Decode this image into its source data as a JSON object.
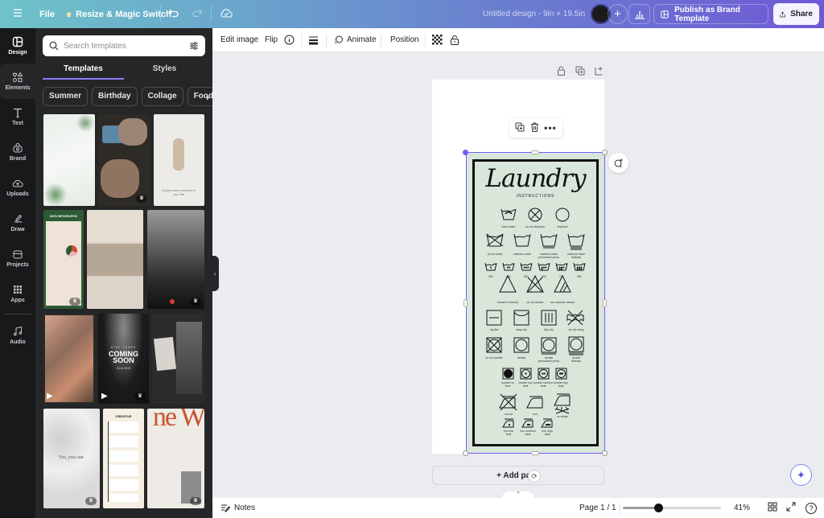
{
  "topbar": {
    "menu_icon": "hamburger-icon",
    "file_label": "File",
    "resize_label": "Resize & Magic Switch",
    "doc_title": "Untitled design - 9in × 19.5in",
    "publish_label": "Publish as Brand Template",
    "share_label": "Share"
  },
  "rail": {
    "items": [
      {
        "label": "Design",
        "icon": "design-icon"
      },
      {
        "label": "Elements",
        "icon": "elements-icon"
      },
      {
        "label": "Text",
        "icon": "text-icon"
      },
      {
        "label": "Brand",
        "icon": "brand-icon"
      },
      {
        "label": "Uploads",
        "icon": "uploads-icon"
      },
      {
        "label": "Draw",
        "icon": "draw-icon"
      },
      {
        "label": "Projects",
        "icon": "projects-icon"
      },
      {
        "label": "Apps",
        "icon": "apps-icon"
      },
      {
        "label": "Audio",
        "icon": "audio-icon"
      }
    ]
  },
  "panel": {
    "search_placeholder": "Search templates",
    "tabs": [
      {
        "label": "Templates"
      },
      {
        "label": "Styles"
      }
    ],
    "chips": [
      {
        "label": "Summer"
      },
      {
        "label": "Birthday"
      },
      {
        "label": "Collage"
      },
      {
        "label": "Food"
      }
    ],
    "thumb_texts": {
      "coming_soon_top": "STAY TUNED",
      "coming_soon": "COMING SOON",
      "coming_soon_date": "30.11.2023",
      "yes_you_can": "Yes, you can.",
      "new": "ne W",
      "creative": "CREATIVE",
      "data_infographic": "DATA INFOGRAPHIC"
    }
  },
  "context_toolbar": {
    "edit_image": "Edit image",
    "flip": "Flip",
    "animate": "Animate",
    "position": "Position"
  },
  "design": {
    "title": "Laundry",
    "subtitle": "INSTRUCTIONS",
    "labels": {
      "r1": [
        "hand wash",
        "do not dryclean",
        "dryclean"
      ],
      "r2": [
        "do not wash",
        "machine wash",
        "machine wash permanent press",
        "machine wash delicate"
      ],
      "r3": [
        "30C",
        "40C",
        "50C",
        "60C",
        "70C",
        "95C"
      ],
      "r4": [
        "bleach if needed",
        "do not bleach",
        "non-chlorine bleach"
      ],
      "r5": [
        "dry flat",
        "hang dry",
        "drip dry",
        "do not wring"
      ],
      "r6": [
        "do not tumble",
        "tumble",
        "tumble permanent press",
        "tumble delicate"
      ],
      "r7": [
        "tumble no heat",
        "tumble low heat",
        "tumble medium heat",
        "tumble high heat"
      ],
      "r8": [
        "no iron",
        "iron",
        "no steam"
      ],
      "r9": [
        "iron low heat",
        "iron medium heat",
        "iron high heat"
      ]
    }
  },
  "canvas": {
    "add_page_label": "+ Add page"
  },
  "bottombar": {
    "notes_label": "Notes",
    "page_label": "Page 1 / 1",
    "zoom_value": "41%",
    "zoom_fraction": 0.41
  }
}
